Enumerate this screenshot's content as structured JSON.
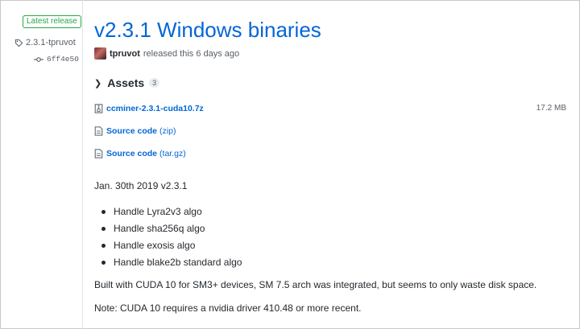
{
  "sidebar": {
    "badge": "Latest release",
    "tag": "2.3.1-tpruvot",
    "commit": "6ff4e50"
  },
  "release": {
    "title": "v2.3.1 Windows binaries",
    "author": "tpruvot",
    "released_text": "released this 6 days ago"
  },
  "assets": {
    "label": "Assets",
    "count": "3",
    "items": [
      {
        "name": "ccminer-2.3.1-cuda10.7z",
        "size": "17.2 MB",
        "icon": "archive-icon"
      },
      {
        "name": "Source code",
        "suffix": "(zip)",
        "icon": "file-zip-icon"
      },
      {
        "name": "Source code",
        "suffix": "(tar.gz)",
        "icon": "file-zip-icon"
      }
    ]
  },
  "notes": {
    "date_line": "Jan. 30th 2019 v2.3.1",
    "bullets": [
      "Handle Lyra2v3 algo",
      "Handle sha256q algo",
      "Handle exosis algo",
      "Handle blake2b standard algo"
    ],
    "built_line": "Built with CUDA 10 for SM3+ devices, SM 7.5 arch was integrated, but seems to only waste disk space.",
    "note_line": "Note: CUDA 10 requires a nvidia driver 410.48 or more recent."
  },
  "colors": {
    "link": "#0366d6",
    "badge_green": "#28a745",
    "muted": "#586069"
  }
}
